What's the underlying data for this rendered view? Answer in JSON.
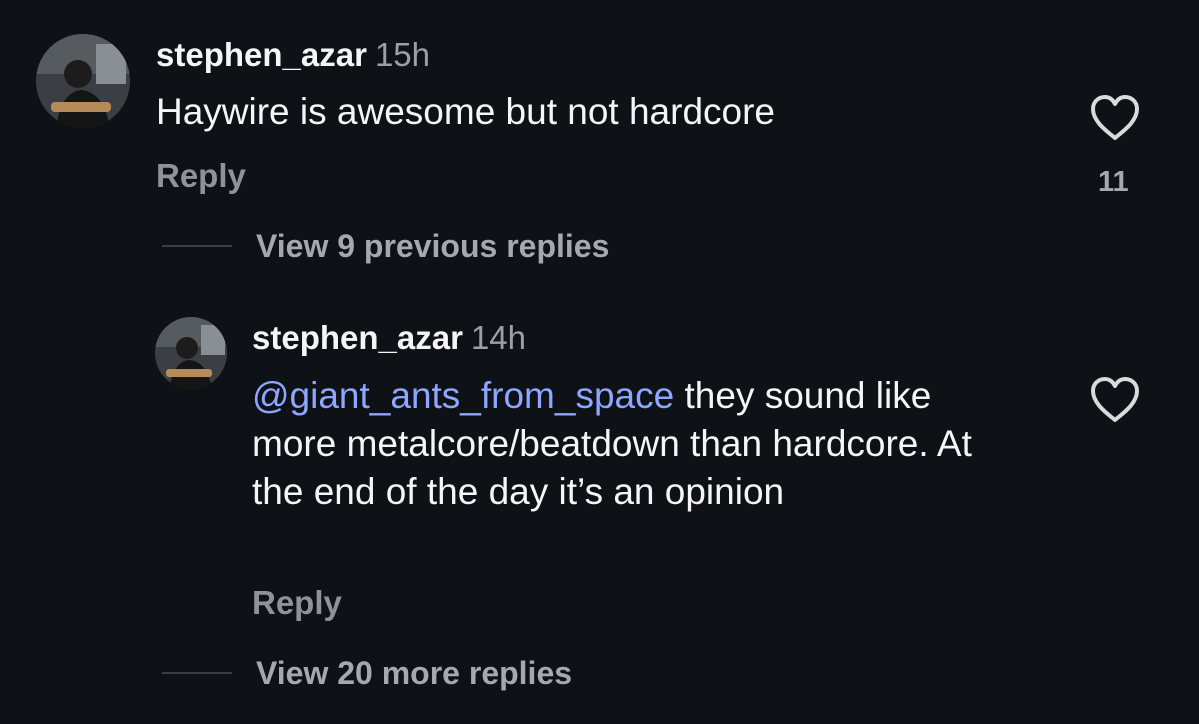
{
  "comment": {
    "username": "stephen_azar",
    "time": "15h",
    "text": "Haywire is awesome but not hardcore",
    "reply_label": "Reply",
    "like_count": "11",
    "avatar_icon": "profile-photo"
  },
  "view_previous": {
    "label": "View 9 previous replies"
  },
  "reply": {
    "username": "stephen_azar",
    "time": "14h",
    "mention": "@giant_ants_from_space",
    "text": " they sound like more metalcore/beatdown than hardcore. At the end of the day it’s an opinion",
    "reply_label": "Reply",
    "avatar_icon": "profile-photo"
  },
  "view_more": {
    "label": "View 20 more replies"
  },
  "colors": {
    "background": "#0e1116",
    "mention": "#8ea6ff",
    "muted": "#9aa0a6"
  }
}
